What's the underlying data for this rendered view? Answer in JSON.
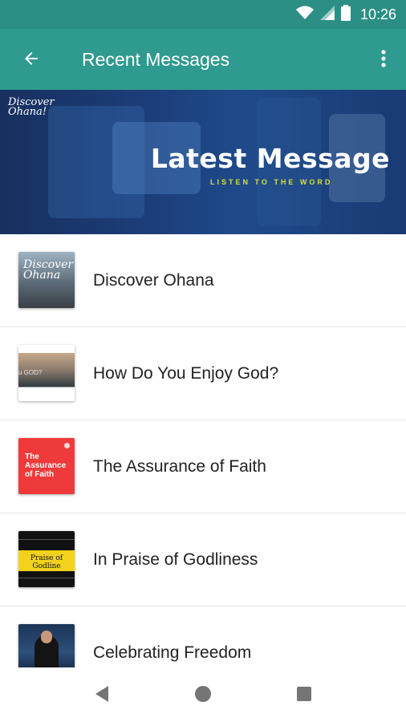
{
  "status_bar": {
    "time": "10:26"
  },
  "app_bar": {
    "title": "Recent Messages"
  },
  "banner": {
    "logo_text": "Discover Ohana!",
    "title": "Latest Message",
    "subtitle": "LISTEN TO THE WORD"
  },
  "messages": [
    {
      "title": "Discover Ohana",
      "thumb_text": "Discover Ohana"
    },
    {
      "title": "How Do You Enjoy God?",
      "thumb_text": "u GOD?"
    },
    {
      "title": "The Assurance of Faith",
      "thumb_text": "The Assurance of Faith"
    },
    {
      "title": "In Praise of Godliness",
      "thumb_text": "Praise of Godline"
    },
    {
      "title": "Celebrating Freedom",
      "thumb_text": ""
    }
  ],
  "colors": {
    "app_bar": "#2f9a8f",
    "status_bar": "#2b8f85",
    "banner": "#1c3d78",
    "accent": "#d8e233"
  }
}
